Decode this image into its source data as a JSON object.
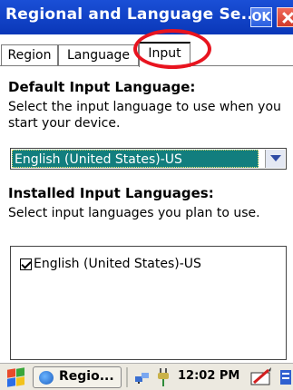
{
  "window": {
    "title": "Regional and Language Se...",
    "ok_label": "OK"
  },
  "tabs": [
    {
      "label": "Region"
    },
    {
      "label": "Language"
    },
    {
      "label": "Input"
    }
  ],
  "default_input": {
    "heading": "Default Input Language:",
    "description": "Select the input language to use when you start your device.",
    "selected_value": "English (United States)-US"
  },
  "installed_input": {
    "heading": "Installed Input Languages:",
    "description": "Select input languages you plan to use.",
    "items": [
      {
        "label": "English (United States)-US",
        "checked": true
      }
    ]
  },
  "taskbar": {
    "app_label": "Regio...",
    "time": "12:02 PM"
  },
  "colors": {
    "title_bar": "#0a37b8",
    "selection": "#127e7e",
    "highlight_annotation": "#e8141f"
  },
  "icons": [
    "start-flag-icon",
    "app-globe-icon",
    "network-icon",
    "power-plug-icon",
    "keyboard-pen-icon"
  ]
}
